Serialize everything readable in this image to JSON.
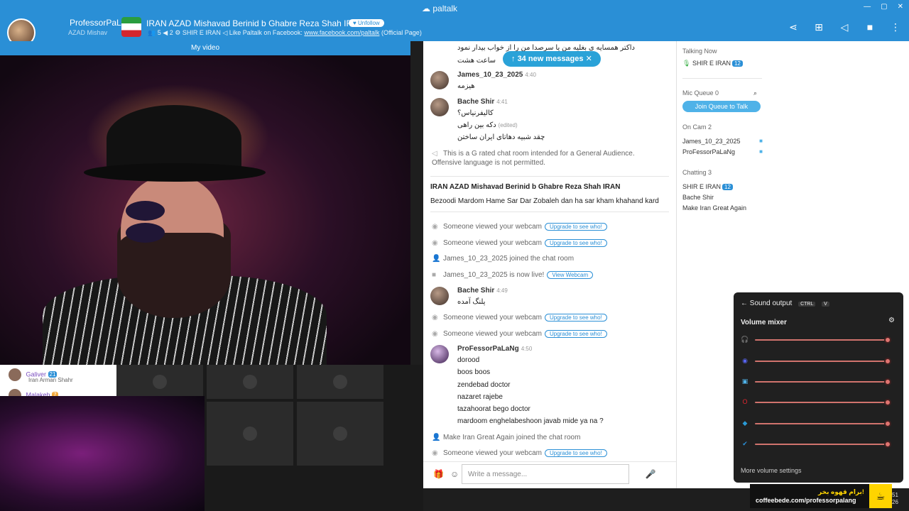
{
  "window": {
    "app_name": "paltalk",
    "controls": [
      "—",
      "▢",
      "✕"
    ]
  },
  "user": {
    "name": "ProfessorPaLaNg",
    "sub": "AZAD Mishav"
  },
  "room": {
    "title": "IRAN AZAD Mishavad Berinid b Ghabre Reza Shah IRAN",
    "unfollow_label": "Unfollow",
    "users_count": "5",
    "mic_count": "2",
    "owner": "SHIR E IRAN",
    "facebook_text": "Like Paltalk on Facebook:",
    "facebook_url": "www.facebook.com/paltalk",
    "facebook_suffix": "(Official Page)"
  },
  "video": {
    "header": "My video"
  },
  "thumbs": [
    {
      "name": "Galiver",
      "badge": "21",
      "sub": "Iran Arman Shahr"
    },
    {
      "name": "Malakeh",
      "badge": "7",
      "sub": ""
    }
  ],
  "chat": {
    "new_messages": "34 new messages",
    "top_lines": [
      "داکتر همسایه ی بغلیه من یا سرصدا من را از خواب بیدار نمود",
      "ساعت هشت"
    ],
    "messages": [
      {
        "name": "James_10_23_2025",
        "time": "4:40",
        "lines": [
          "هیزمه"
        ]
      },
      {
        "name": "Bache Shir",
        "time": "4:41",
        "lines": [
          "کالیفرنیاس؟",
          "دکه بین راهی",
          "چقد شبیه دهاتای ایران ساختن"
        ],
        "edited": "(edited)"
      }
    ],
    "notice": "This is a G rated chat room intended for a General Audience. Offensive language is not permitted.",
    "room_title": "IRAN AZAD Mishavad Berinid b Ghabre Reza Shah IRAN",
    "room_desc": "Bezoodi Mardom Hame Sar Dar Zobaleh dan ha sar kham khahand kard",
    "viewed_text": "Someone viewed your webcam",
    "upgrade_label": "Upgrade to see who!",
    "joined_james": "James_10_23_2025 joined the chat room",
    "live_james": "James_10_23_2025 is now live!",
    "view_webcam": "View Webcam",
    "msg_bache2": {
      "name": "Bache Shir",
      "time": "4:49",
      "line": "پلنگ آمده"
    },
    "msg_prof": {
      "name": "ProFessorPaLaNg",
      "time": "4:50",
      "lines": [
        "dorood",
        "boos boos",
        "zendebad doctor",
        "nazaret rajebe",
        "tazahoorat bego doctor",
        "mardoom enghelabeshoon javab mide ya na ?"
      ]
    },
    "joined_make": "Make Iran Great Again joined the chat room",
    "composer_placeholder": "Write a message..."
  },
  "sidebar": {
    "talking_now": "Talking Now",
    "talking_user": "SHIR E IRAN",
    "talking_badge": "12",
    "mic_queue": "Mic Queue",
    "mic_queue_count": "0",
    "join_queue": "Join Queue to Talk",
    "on_cam": "On Cam",
    "on_cam_count": "2",
    "cam_users": [
      "James_10_23_2025",
      "ProFessorPaLaNg"
    ],
    "chatting": "Chatting",
    "chatting_count": "3",
    "chat_users": [
      "SHIR E IRAN",
      "Bache Shir",
      "Make Iran Great Again"
    ]
  },
  "mixer": {
    "title": "Sound output",
    "shortcut_ctrl": "CTRL",
    "shortcut_key": "V",
    "section": "Volume mixer",
    "footer": "More volume settings",
    "rows": [
      {
        "icon": "headphones-icon",
        "glyph": "🎧",
        "color": "#d0d0d0",
        "level": 1.0
      },
      {
        "icon": "discord-icon",
        "glyph": "◉",
        "color": "#5865f2",
        "level": 1.0
      },
      {
        "icon": "window-app-icon",
        "glyph": "▣",
        "color": "#4fb2e8",
        "level": 1.0
      },
      {
        "icon": "opera-icon",
        "glyph": "O",
        "color": "#e0262f",
        "level": 1.0
      },
      {
        "icon": "paltalk-icon",
        "glyph": "◆",
        "color": "#2a9bd6",
        "level": 1.0
      },
      {
        "icon": "checkmark-app-icon",
        "glyph": "✔",
        "color": "#2a8fd6",
        "level": 1.0
      }
    ]
  },
  "coffee": {
    "persian": "برام قهوه بخر!",
    "url": "coffeebede.com/professorpalang"
  },
  "clock": {
    "time_tail": "51",
    "date_tail": "26"
  }
}
